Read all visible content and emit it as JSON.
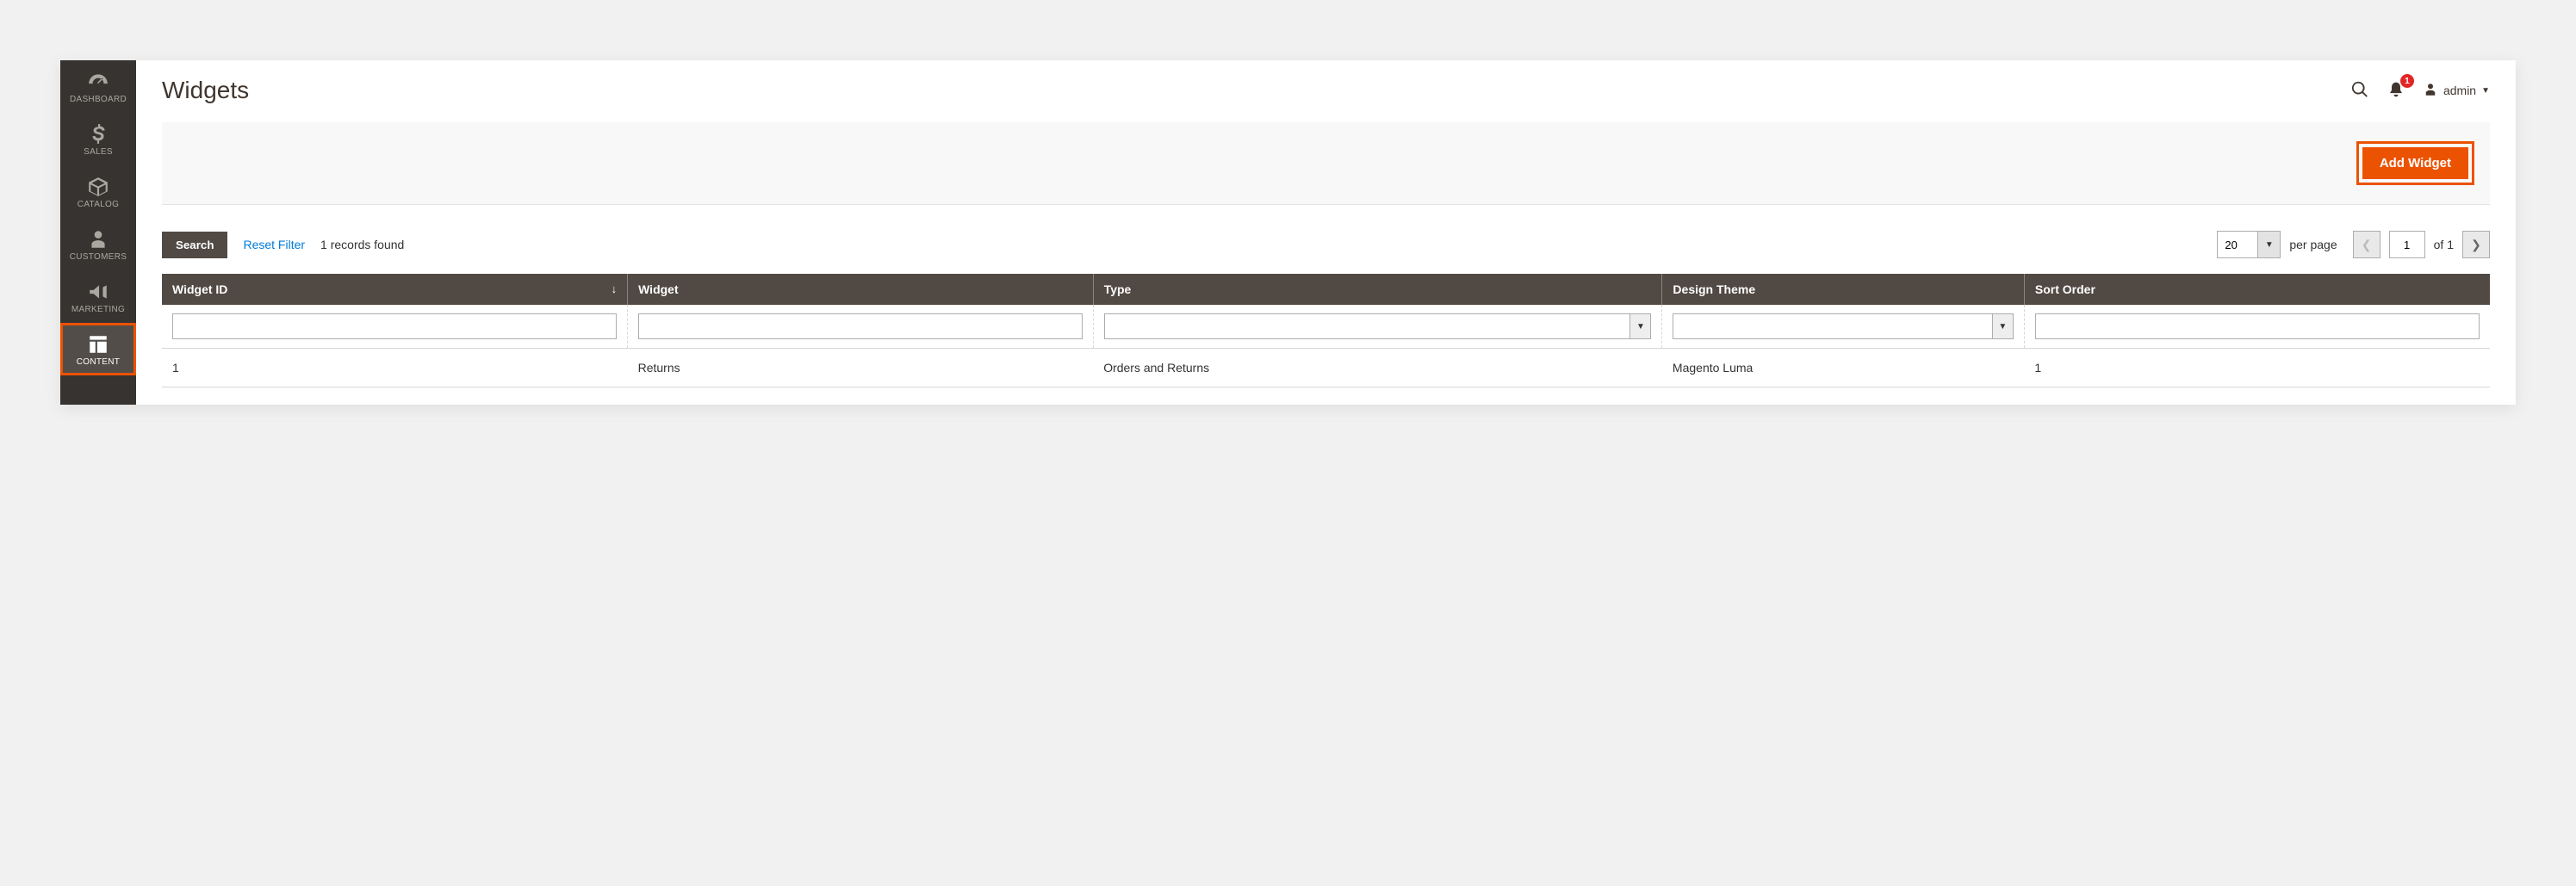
{
  "sidebar": {
    "items": [
      {
        "id": "dashboard",
        "label": "DASHBOARD"
      },
      {
        "id": "sales",
        "label": "SALES"
      },
      {
        "id": "catalog",
        "label": "CATALOG"
      },
      {
        "id": "customers",
        "label": "CUSTOMERS"
      },
      {
        "id": "marketing",
        "label": "MARKETING"
      },
      {
        "id": "content",
        "label": "CONTENT",
        "active": true
      }
    ]
  },
  "header": {
    "title": "Widgets",
    "notifications_count": "1",
    "user_label": "admin"
  },
  "actions": {
    "add_widget_label": "Add Widget"
  },
  "grid_controls": {
    "search_label": "Search",
    "reset_label": "Reset Filter",
    "records_found": "1 records found",
    "per_page_value": "20",
    "per_page_label": "per page",
    "page_current": "1",
    "page_total_label": "of 1"
  },
  "table": {
    "headers": {
      "widget_id": "Widget ID",
      "widget": "Widget",
      "type": "Type",
      "design_theme": "Design Theme",
      "sort_order": "Sort Order"
    },
    "rows": [
      {
        "widget_id": "1",
        "widget": "Returns",
        "type": "Orders and Returns",
        "design_theme": "Magento Luma",
        "sort_order": "1"
      }
    ]
  }
}
